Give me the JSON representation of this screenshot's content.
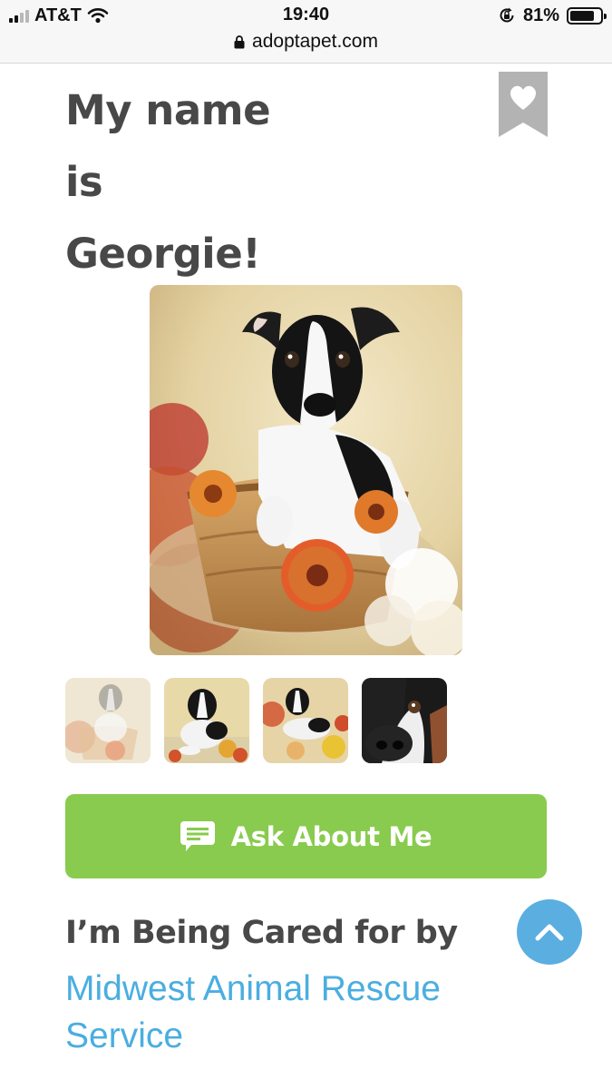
{
  "status_bar": {
    "carrier": "AT&T",
    "time": "19:40",
    "battery": "81%",
    "battery_level": 0.81,
    "url": "adoptapet.com"
  },
  "pet": {
    "title_line1": "My name",
    "title_line2": "is",
    "title_line3": "Georgie!",
    "favorite_icon": "bookmark-heart-icon",
    "thumbnail_count": 4
  },
  "actions": {
    "ask_label": "Ask About Me",
    "ask_icon": "chat-bubble-icon",
    "ask_color": "#89cb4e"
  },
  "caretaker": {
    "heading": "I’m Being Cared for by",
    "name": "Midwest Animal Rescue Service",
    "link_color": "#4aaee0"
  },
  "scroll_top": {
    "icon": "chevron-up-icon",
    "color": "#5aaee0"
  }
}
